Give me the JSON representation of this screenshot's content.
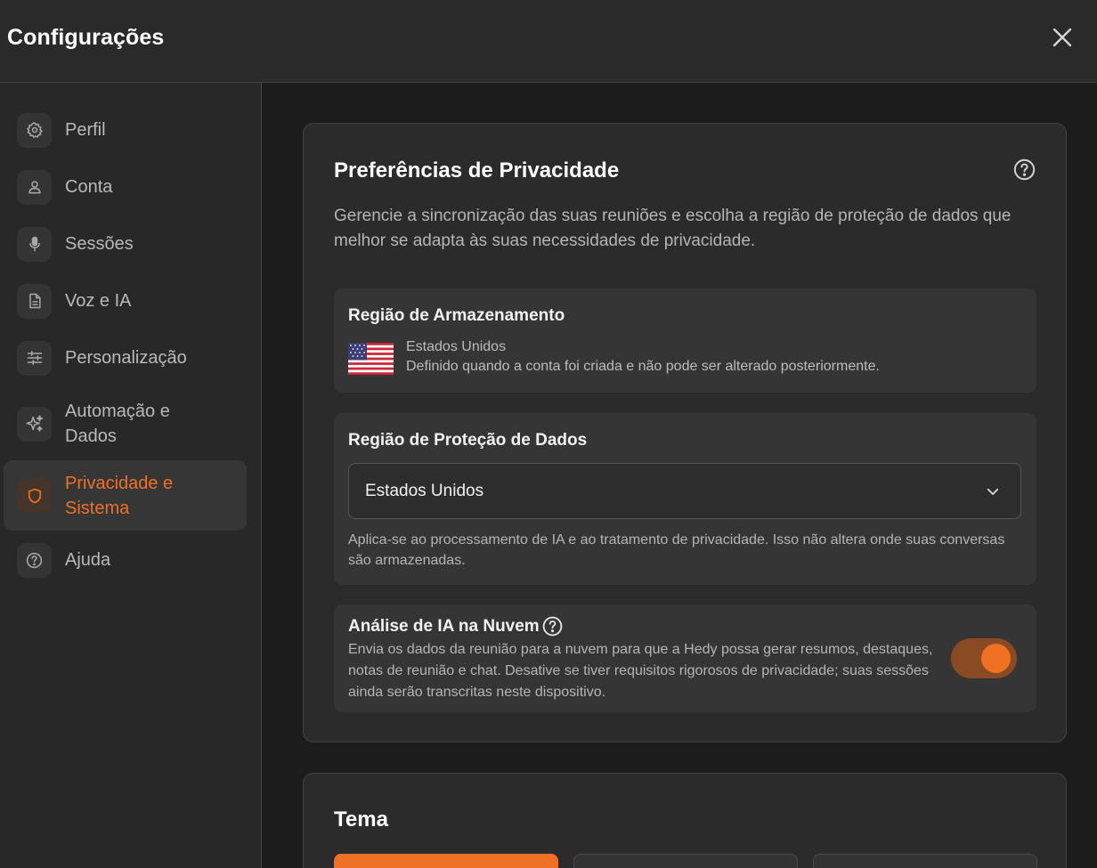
{
  "header": {
    "title": "Configurações"
  },
  "sidebar": {
    "items": [
      {
        "label": "Perfil",
        "icon": "gear-icon"
      },
      {
        "label": "Conta",
        "icon": "user-icon"
      },
      {
        "label": "Sessões",
        "icon": "microphone-icon"
      },
      {
        "label": "Voz e IA",
        "icon": "document-icon"
      },
      {
        "label": "Personalização",
        "icon": "sliders-icon"
      },
      {
        "label": "Automação e Dados",
        "icon": "sparkles-icon"
      },
      {
        "label": "Privacidade e Sistema",
        "icon": "shield-icon",
        "active": true
      },
      {
        "label": "Ajuda",
        "icon": "help-circle-icon"
      }
    ]
  },
  "privacy": {
    "title": "Preferências de Privacidade",
    "description": "Gerencie a sincronização das suas reuniões e escolha a região de proteção de dados que melhor se adapta às suas necessidades de privacidade.",
    "storage": {
      "title": "Região de Armazenamento",
      "region": "Estados Unidos",
      "note": "Definido quando a conta foi criada e não pode ser alterado posteriormente.",
      "flag_icon": "us-flag-icon"
    },
    "protection": {
      "title": "Região de Proteção de Dados",
      "selected": "Estados Unidos",
      "note": "Aplica-se ao processamento de IA e ao tratamento de privacidade. Isso não altera onde suas conversas são armazenadas."
    },
    "cloud_ai": {
      "title": "Análise de IA na Nuvem",
      "description": "Envia os dados da reunião para a nuvem para que a Hedy possa gerar resumos, destaques, notas de reunião e chat. Desative se tiver requisitos rigorosos de privacidade; suas sessões ainda serão transcritas neste dispositivo.",
      "enabled": true
    }
  },
  "theme": {
    "title": "Tema"
  },
  "colors": {
    "accent": "#ee7126",
    "background": "#1c1c1c",
    "card": "#2b2b2b",
    "section": "#353535"
  }
}
